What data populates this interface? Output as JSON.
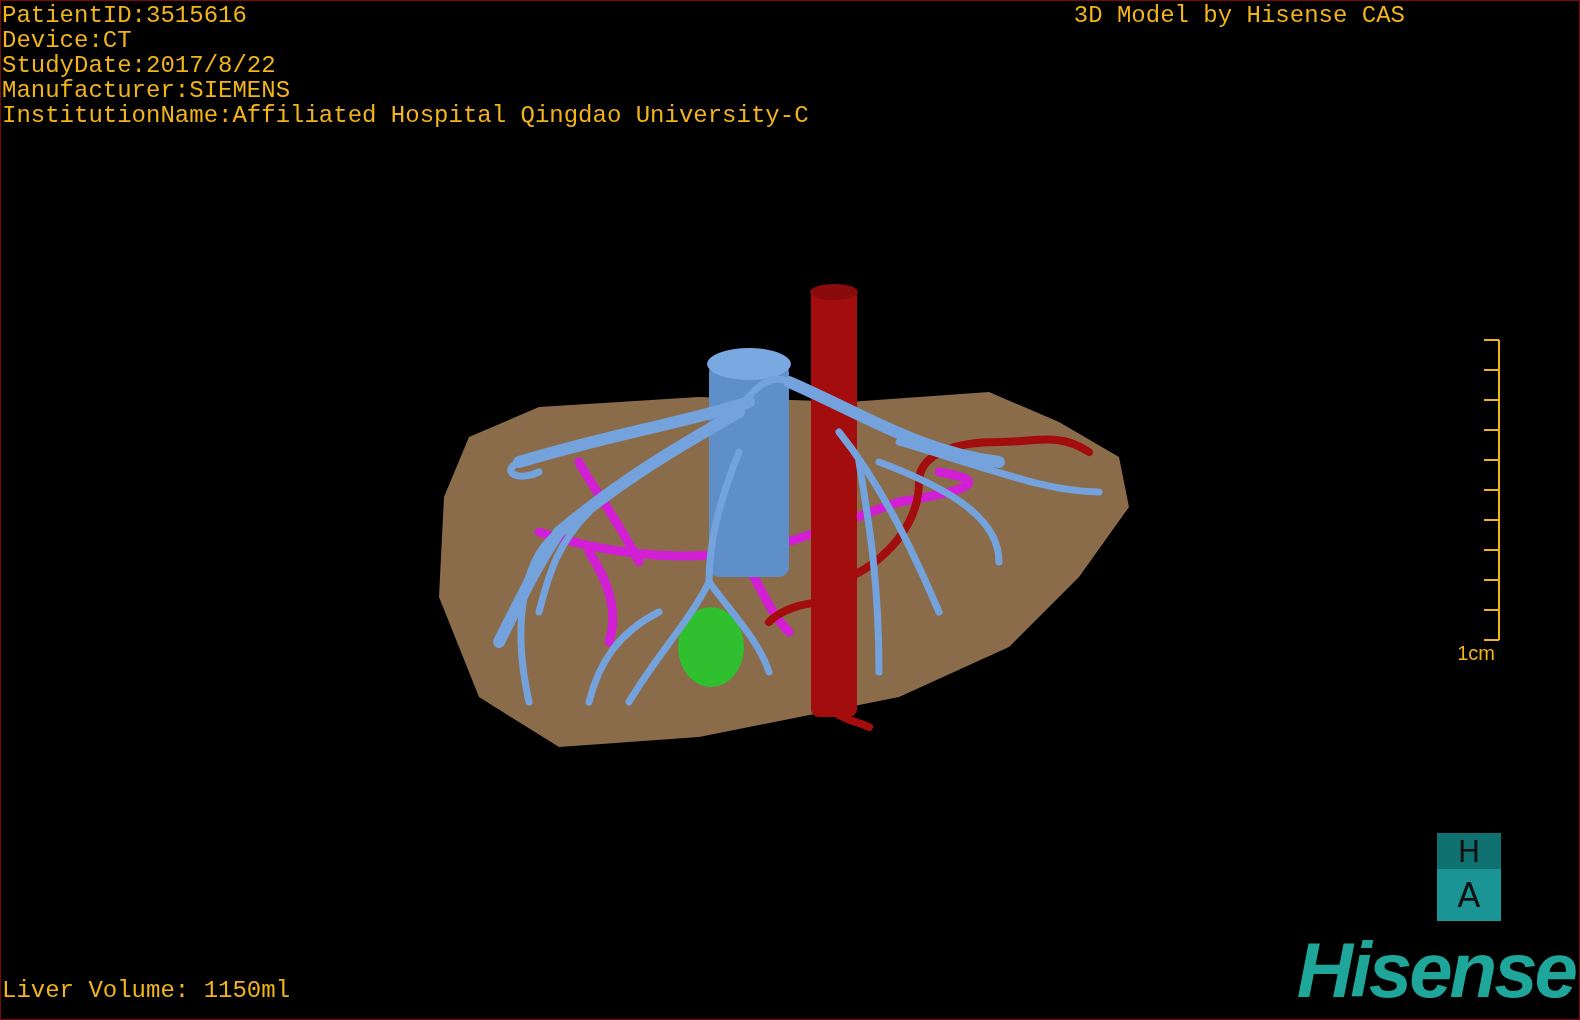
{
  "patient_info": [
    "PatientID:3515616",
    "Device:CT",
    "StudyDate:2017/8/22",
    "Manufacturer:SIEMENS",
    "InstitutionName:Affiliated Hospital Qingdao University-C"
  ],
  "caption": "3D Model by Hisense CAS",
  "scale_bar": {
    "label": "1cm"
  },
  "orientation_cube": {
    "top": "H",
    "front": "A"
  },
  "liver_volume": "Liver Volume: 1150ml",
  "logo": "Hisense"
}
